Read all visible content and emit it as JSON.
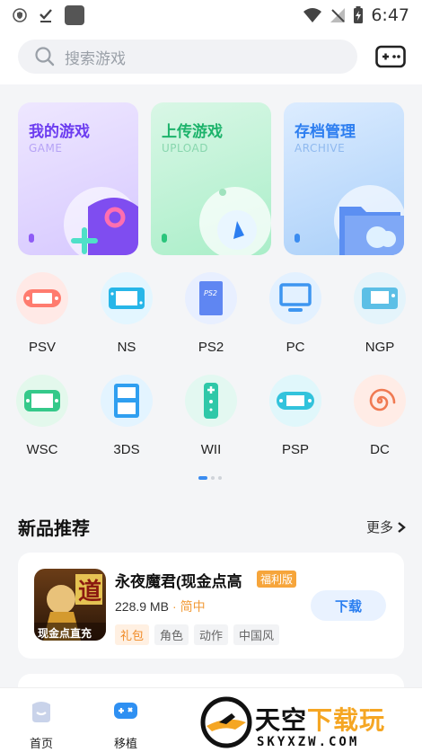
{
  "status_bar": {
    "time": "6:47"
  },
  "search": {
    "placeholder": "搜索游戏"
  },
  "cards": [
    {
      "title": "我的游戏",
      "subtitle": "GAME"
    },
    {
      "title": "上传游戏",
      "subtitle": "UPLOAD"
    },
    {
      "title": "存档管理",
      "subtitle": "ARCHIVE"
    }
  ],
  "consoles": [
    {
      "label": "PSV"
    },
    {
      "label": "NS"
    },
    {
      "label": "PS2"
    },
    {
      "label": "PC"
    },
    {
      "label": "NGP"
    },
    {
      "label": "WSC"
    },
    {
      "label": "3DS"
    },
    {
      "label": "WII"
    },
    {
      "label": "PSP"
    },
    {
      "label": "DC"
    }
  ],
  "consoles_ps2_icon_text": "PS2",
  "section": {
    "title": "新品推荐",
    "more": "更多"
  },
  "game": {
    "name": "永夜魔君(现金点高",
    "badge": "福利版",
    "size": "228.9 MB",
    "separator": "·",
    "language": "简中",
    "tags": [
      "礼包",
      "角色",
      "动作",
      "中国风"
    ],
    "download": "下载",
    "cover_glyph": "道",
    "cover_caption": "现金点直充"
  },
  "bottom_nav": [
    {
      "label": "首页"
    },
    {
      "label": "移植"
    }
  ],
  "watermark": {
    "brand": "天空",
    "brand_accent": "下载玩",
    "url": "SKYXZW.COM"
  },
  "colors": {
    "accent": "#3b8cf0",
    "orange": "#f29b38"
  }
}
